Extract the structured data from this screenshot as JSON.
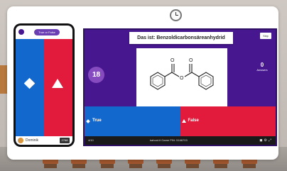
{
  "phone": {
    "pill_label": "True or False",
    "player_name": "Dominik",
    "score": "2768"
  },
  "host": {
    "question": "Das ist: Benzoldicarbonsäreanhydrid",
    "skip_label": "Skip",
    "timer": "18",
    "answers_count": "0",
    "answers_label": "Answers",
    "answer_true": "True",
    "answer_false": "False",
    "question_number": "4/10",
    "game_pin_text": "kahoot.it  Game PIN: 5168703"
  },
  "colors": {
    "kahoot_purple": "#46178f",
    "answer_blue": "#1368ce",
    "answer_red": "#e21b3c"
  },
  "icons": [
    "clock-icon",
    "diamond-icon",
    "triangle-icon",
    "lock-icon",
    "settings-icon",
    "fullscreen-icon"
  ]
}
